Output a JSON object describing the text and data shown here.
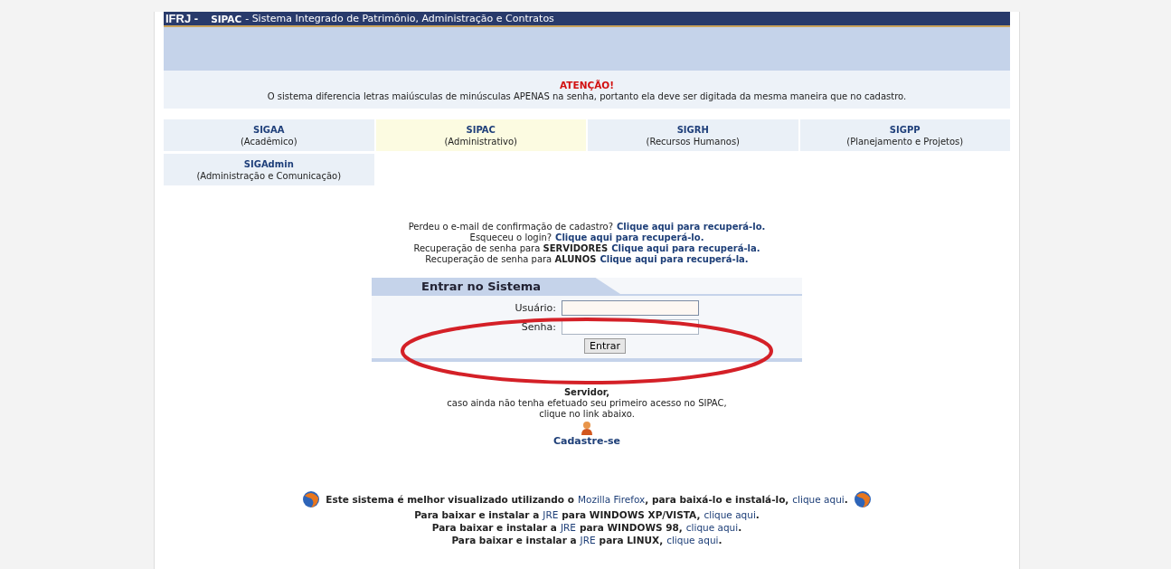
{
  "header": {
    "org": "IFRJ -",
    "system": "SIPAC",
    "title": "- Sistema Integrado de Patrimônio, Administração e Contratos"
  },
  "notice": {
    "heading": "ATENÇÃO!",
    "text": "O sistema diferencia letras maiúsculas de minúsculas APENAS na senha, portanto ela deve ser digitada da mesma maneira que no cadastro."
  },
  "systems": [
    {
      "name": "SIGAA",
      "description": "(Acadêmico)",
      "selected": false
    },
    {
      "name": "SIPAC",
      "description": "(Administrativo)",
      "selected": true
    },
    {
      "name": "SIGRH",
      "description": "(Recursos Humanos)",
      "selected": false
    },
    {
      "name": "SIGPP",
      "description": "(Planejamento e Projetos)",
      "selected": false
    },
    {
      "name": "SIGAdmin",
      "description": "(Administração e Comunicação)",
      "selected": false
    }
  ],
  "recovery_links": [
    {
      "text": "Perdeu o e-mail de confirmação de cadastro?",
      "link": "Clique aqui para recuperá-lo."
    },
    {
      "text": "Esqueceu o login?",
      "link": "Clique aqui para recuperá-lo."
    },
    {
      "text": "Recuperação de senha para **SERVIDORES**",
      "link": "Clique aqui para recuperá-la."
    },
    {
      "text": "Recuperação de senha para **ALUNOS**",
      "link": "Clique aqui para recuperá-la."
    }
  ],
  "login": {
    "title": "Entrar no Sistema",
    "fields": [
      {
        "label": "Usuário:",
        "kind": "text"
      },
      {
        "label": "Senha:",
        "kind": "password"
      }
    ],
    "button": "Entrar"
  },
  "register": {
    "heading": "Servidor,",
    "lines": [
      "caso ainda não tenha efetuado seu primeiro acesso no SIPAC,",
      "clique no link abaixo."
    ],
    "link": "Cadastre-se"
  },
  "browser_note": {
    "before": "Este sistema é melhor visualizado utilizando o",
    "browser": "Mozilla Firefox",
    "middle": ", para baixá-lo e instalá-lo,",
    "link": "clique aqui",
    "end": "."
  },
  "jre_lines": [
    {
      "before": "Para baixar e instalar a",
      "jre": "JRE",
      "after": "para WINDOWS XP/VISTA,",
      "link": "clique aqui",
      "end": "."
    },
    {
      "before": "Para baixar e instalar a",
      "jre": "JRE",
      "after": "para WINDOWS 98,",
      "link": "clique aqui",
      "end": "."
    },
    {
      "before": "Para baixar e instalar a",
      "jre": "JRE",
      "after": "para LINUX,",
      "link": "clique aqui",
      "end": "."
    }
  ],
  "annotation": {
    "kind": "ellipse",
    "color": "#d42027"
  }
}
